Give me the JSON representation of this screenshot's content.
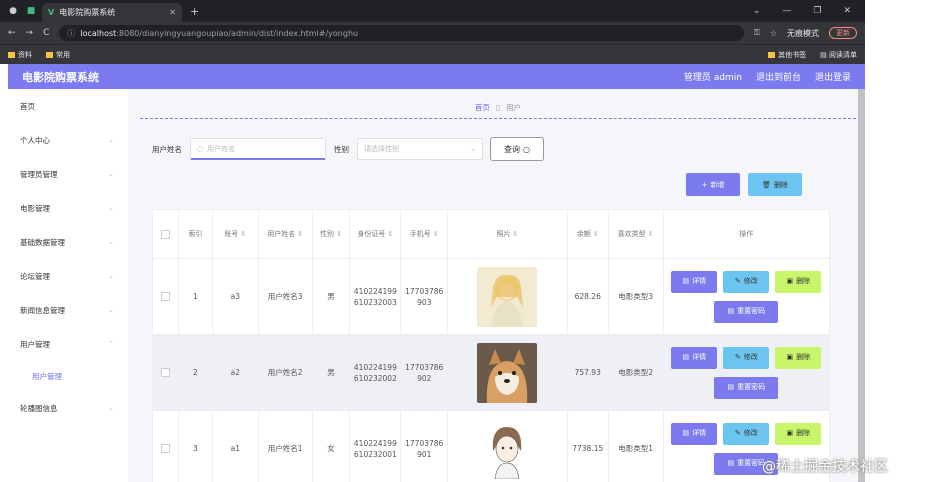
{
  "browser": {
    "tab_title": "电影院购票系统",
    "url_host": "localhost",
    "url_rest": ":8080/dianyingyuangoupiao/admin/dist/index.html#/yonghu",
    "incognito_label": "无痕模式",
    "update_label": "更新",
    "bookmarks": [
      "资料",
      "常用"
    ],
    "bookmarks_right": [
      "其他书签",
      "阅读清单"
    ]
  },
  "header": {
    "title": "电影院购票系统",
    "admin_label": "管理员 admin",
    "to_front": "退出到前台",
    "logout": "退出登录"
  },
  "sidebar": {
    "items": [
      {
        "label": "首页",
        "has_children": false
      },
      {
        "label": "个人中心",
        "has_children": true
      },
      {
        "label": "管理员管理",
        "has_children": true
      },
      {
        "label": "电影管理",
        "has_children": true
      },
      {
        "label": "基础数据管理",
        "has_children": true
      },
      {
        "label": "论坛管理",
        "has_children": true
      },
      {
        "label": "新闻信息管理",
        "has_children": true
      },
      {
        "label": "用户管理",
        "has_children": true,
        "expanded": true
      },
      {
        "label": "轮播图信息",
        "has_children": true
      }
    ],
    "subitem": "用户管理"
  },
  "breadcrumb": {
    "home": "首页",
    "current": "用户"
  },
  "search": {
    "name_label": "用户姓名",
    "name_placeholder": "用户姓名",
    "sex_label": "性别",
    "sex_placeholder": "请选择性别",
    "query_label": "查询"
  },
  "toolbar": {
    "add_label": "新增",
    "delete_label": "删除"
  },
  "table": {
    "headers": [
      "",
      "索引",
      "账号",
      "用户姓名",
      "性别",
      "身份证号",
      "手机号",
      "照片",
      "余额",
      "喜欢类型",
      "操作"
    ],
    "rows": [
      {
        "index": "1",
        "account": "a3",
        "name": "用户姓名3",
        "sex": "男",
        "id_card": "410224199610232003",
        "phone": "17703786903",
        "photo": "anime-girl-photo",
        "balance": "628.26",
        "type": "电影类型3"
      },
      {
        "index": "2",
        "account": "a2",
        "name": "用户姓名2",
        "sex": "男",
        "id_card": "410224199610232002",
        "phone": "17703786902",
        "photo": "shiba-dog-photo",
        "balance": "757.93",
        "type": "电影类型2"
      },
      {
        "index": "3",
        "account": "a1",
        "name": "用户姓名1",
        "sex": "女",
        "id_card": "410224199610232001",
        "phone": "17703786901",
        "photo": "sketch-girl-photo",
        "balance": "7738.15",
        "type": "电影类型1"
      }
    ],
    "ops": {
      "detail": "详情",
      "edit": "修改",
      "delete": "删除",
      "reset": "重置密码"
    }
  },
  "watermark": "@稀土掘金技术社区",
  "colors": {
    "primary": "#7b7bef",
    "info": "#6cc4f0",
    "lime": "#c9f56a"
  }
}
